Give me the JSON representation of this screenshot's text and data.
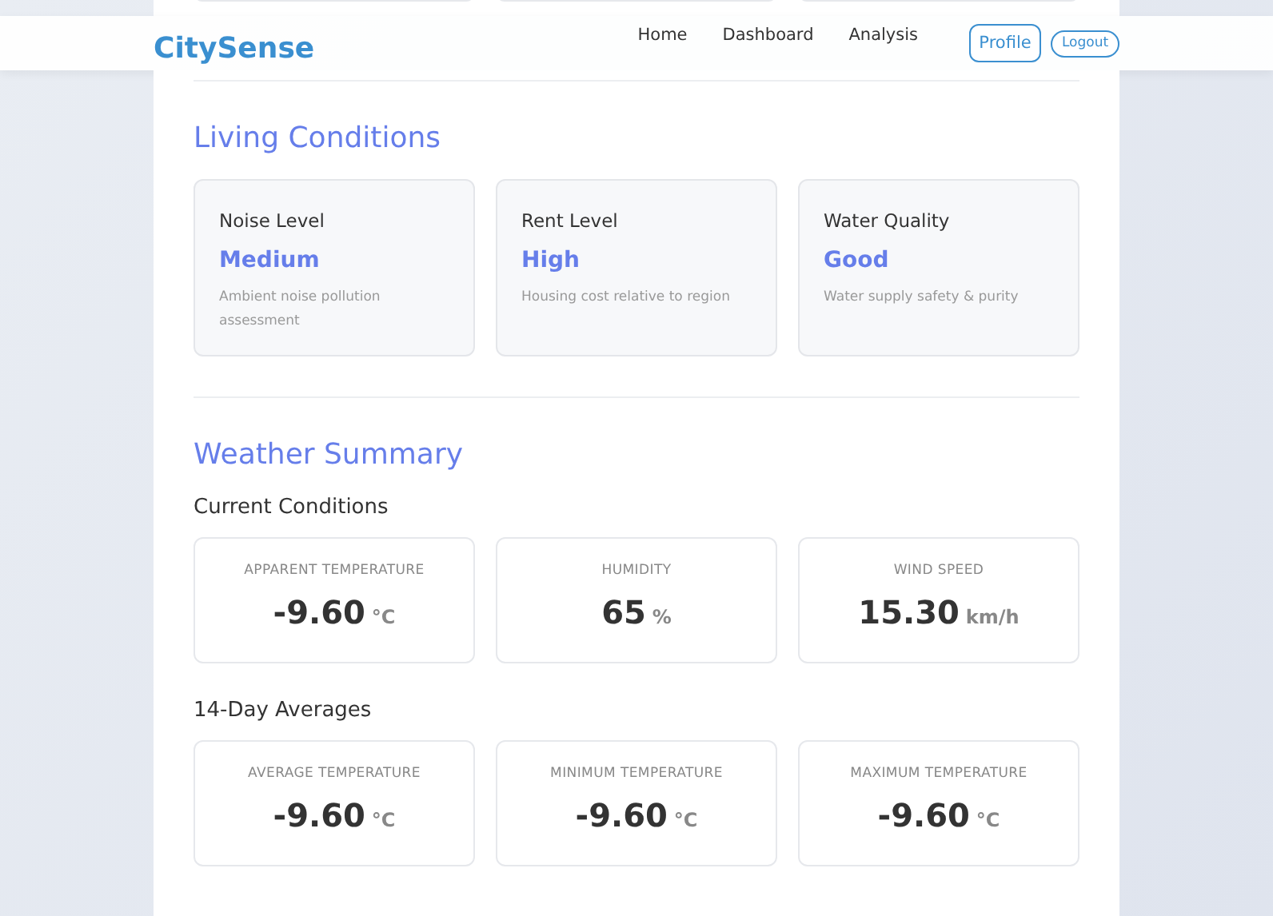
{
  "header": {
    "logo": "CitySense",
    "nav": [
      {
        "label": "Home",
        "selected": false
      },
      {
        "label": "Dashboard",
        "selected": false
      },
      {
        "label": "Analysis",
        "selected": false
      }
    ],
    "buttons": [
      {
        "label": "Profile",
        "kind": "outline"
      },
      {
        "label": "Logout",
        "kind": "small"
      }
    ]
  },
  "living_conditions": {
    "title": "Living Conditions",
    "cards": [
      {
        "label": "Noise Level",
        "value": "Medium",
        "description": "Ambient noise pollution assessment"
      },
      {
        "label": "Rent Level",
        "value": "High",
        "description": "Housing cost relative to region"
      },
      {
        "label": "Water Quality",
        "value": "Good",
        "description": "Water supply safety & purity"
      }
    ]
  },
  "weather_summary": {
    "title": "Weather Summary",
    "groups": [
      {
        "title": "Current Conditions",
        "metrics": [
          {
            "label": "APPARENT TEMPERATURE",
            "value": "-9.60",
            "unit": "°C"
          },
          {
            "label": "HUMIDITY",
            "value": "65",
            "unit": "%"
          },
          {
            "label": "WIND SPEED",
            "value": "15.30",
            "unit": "km/h"
          }
        ]
      },
      {
        "title": "14-Day Averages",
        "metrics": [
          {
            "label": "AVERAGE TEMPERATURE",
            "value": "-9.60",
            "unit": "°C"
          },
          {
            "label": "MINIMUM TEMPERATURE",
            "value": "-9.60",
            "unit": "°C"
          },
          {
            "label": "MAXIMUM TEMPERATURE",
            "value": "-9.60",
            "unit": "°C"
          }
        ]
      }
    ]
  }
}
